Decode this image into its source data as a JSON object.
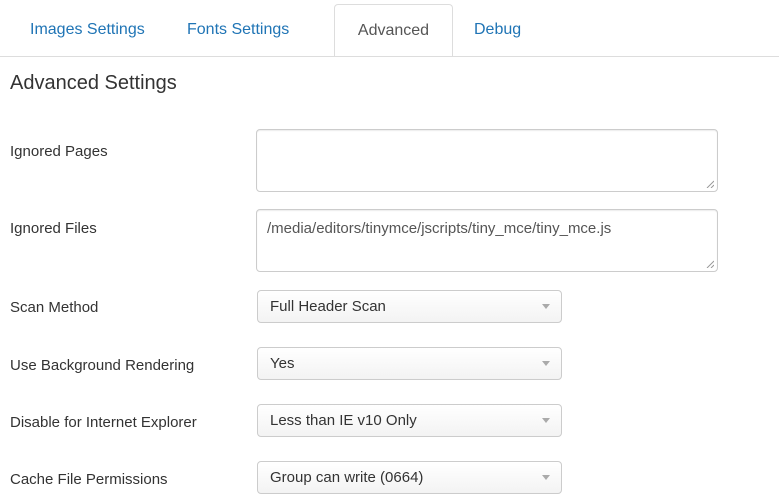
{
  "tabs": [
    {
      "label": "Images Settings",
      "active": false
    },
    {
      "label": "Fonts Settings",
      "active": false
    },
    {
      "label": "Advanced",
      "active": true
    },
    {
      "label": "Debug",
      "active": false
    }
  ],
  "section_title": "Advanced Settings",
  "fields": {
    "ignored_pages": {
      "label": "Ignored Pages",
      "value": ""
    },
    "ignored_files": {
      "label": "Ignored Files",
      "value": "/media/editors/tinymce/jscripts/tiny_mce/tiny_mce.js"
    },
    "scan_method": {
      "label": "Scan Method",
      "value": "Full Header Scan"
    },
    "background_rendering": {
      "label": "Use Background Rendering",
      "value": "Yes"
    },
    "disable_ie": {
      "label": "Disable for Internet Explorer",
      "value": "Less than IE v10 Only"
    },
    "cache_permissions": {
      "label": "Cache File Permissions",
      "value": "Group can write (0664)"
    }
  },
  "colors": {
    "link": "#1f74b5",
    "border": "#dddddd",
    "text": "#333333"
  }
}
